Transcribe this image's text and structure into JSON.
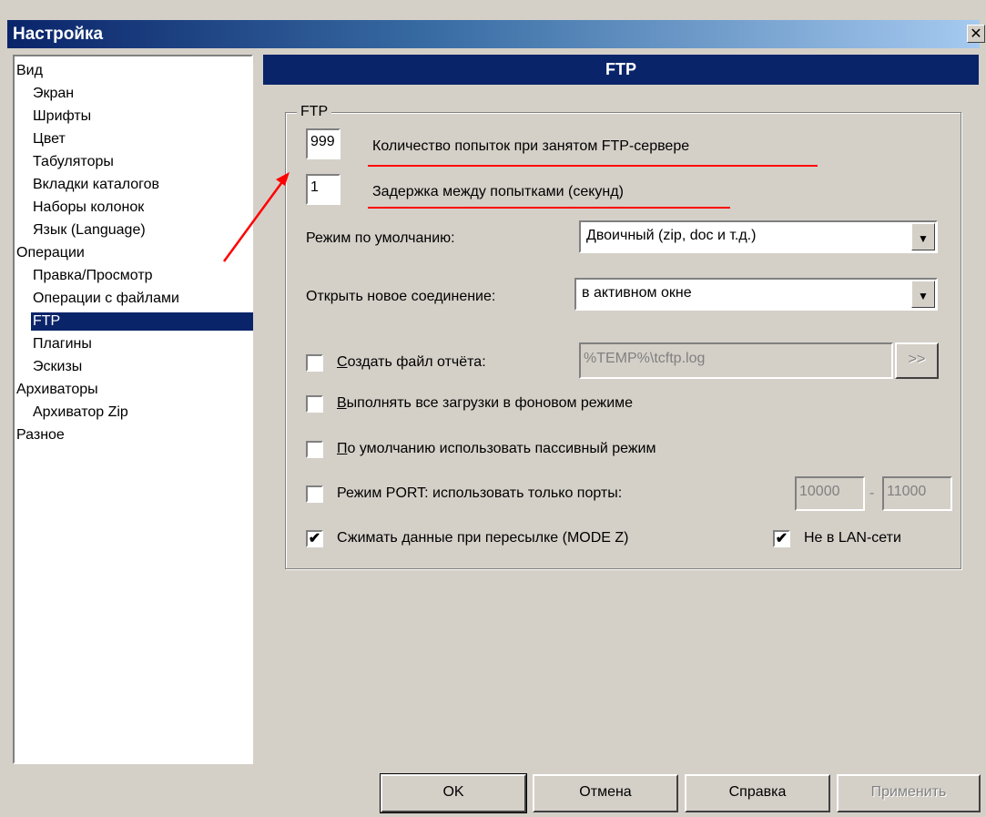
{
  "window": {
    "title": "Настройка",
    "close_glyph": "✕"
  },
  "tree": {
    "items": [
      {
        "label": "Вид",
        "level": 0
      },
      {
        "label": "Экран",
        "level": 1
      },
      {
        "label": "Шрифты",
        "level": 1
      },
      {
        "label": "Цвет",
        "level": 1
      },
      {
        "label": "Табуляторы",
        "level": 1
      },
      {
        "label": "Вкладки каталогов",
        "level": 1
      },
      {
        "label": "Наборы колонок",
        "level": 1
      },
      {
        "label": "Язык (Language)",
        "level": 1
      },
      {
        "label": "Операции",
        "level": 0
      },
      {
        "label": "Правка/Просмотр",
        "level": 1
      },
      {
        "label": "Операции с файлами",
        "level": 1
      },
      {
        "label": "FTP",
        "level": 1,
        "selected": true
      },
      {
        "label": "Плагины",
        "level": 1
      },
      {
        "label": "Эскизы",
        "level": 1
      },
      {
        "label": "Архиваторы",
        "level": 0
      },
      {
        "label": "Архиватор Zip",
        "level": 1
      },
      {
        "label": "Разное",
        "level": 0
      }
    ]
  },
  "panel": {
    "header": "FTP",
    "group_label": "FTP"
  },
  "fields": {
    "retries_value": "999",
    "retries_label": "Количество попыток при занятом FTP-сервере",
    "delay_value": "1",
    "delay_label": "Задержка между попытками (секунд)",
    "mode_label": "Режим по умолчанию:",
    "mode_value": "Двоичный (zip, doc и т.д.)",
    "newconn_label": "Открыть новое соединение:",
    "newconn_value": "в активном окне",
    "logfile_label": "Создать файл отчёта:",
    "logfile_value": "%TEMP%\\tcftp.log",
    "logfile_browse": ">>",
    "background_label": "Выполнять все загрузки в фоновом режиме",
    "passive_label": "По умолчанию использовать пассивный режим",
    "port_label": "Режим PORT: использовать только порты:",
    "port_from": "10000",
    "port_sep": "-",
    "port_to": "11000",
    "compress_label": "Сжимать данные при пересылке (MODE Z)",
    "notlan_label": "Не в LAN-сети"
  },
  "checks": {
    "logfile": false,
    "background": false,
    "passive": false,
    "port": false,
    "compress": true,
    "notlan": true,
    "check_glyph": "✔"
  },
  "buttons": {
    "ok": "OK",
    "cancel": "Отмена",
    "help": "Справка",
    "apply": "Применить"
  },
  "annotation": {
    "color": "#ff0000"
  },
  "icons": {
    "dropdown": "arrow-down-icon",
    "close": "close-icon"
  }
}
